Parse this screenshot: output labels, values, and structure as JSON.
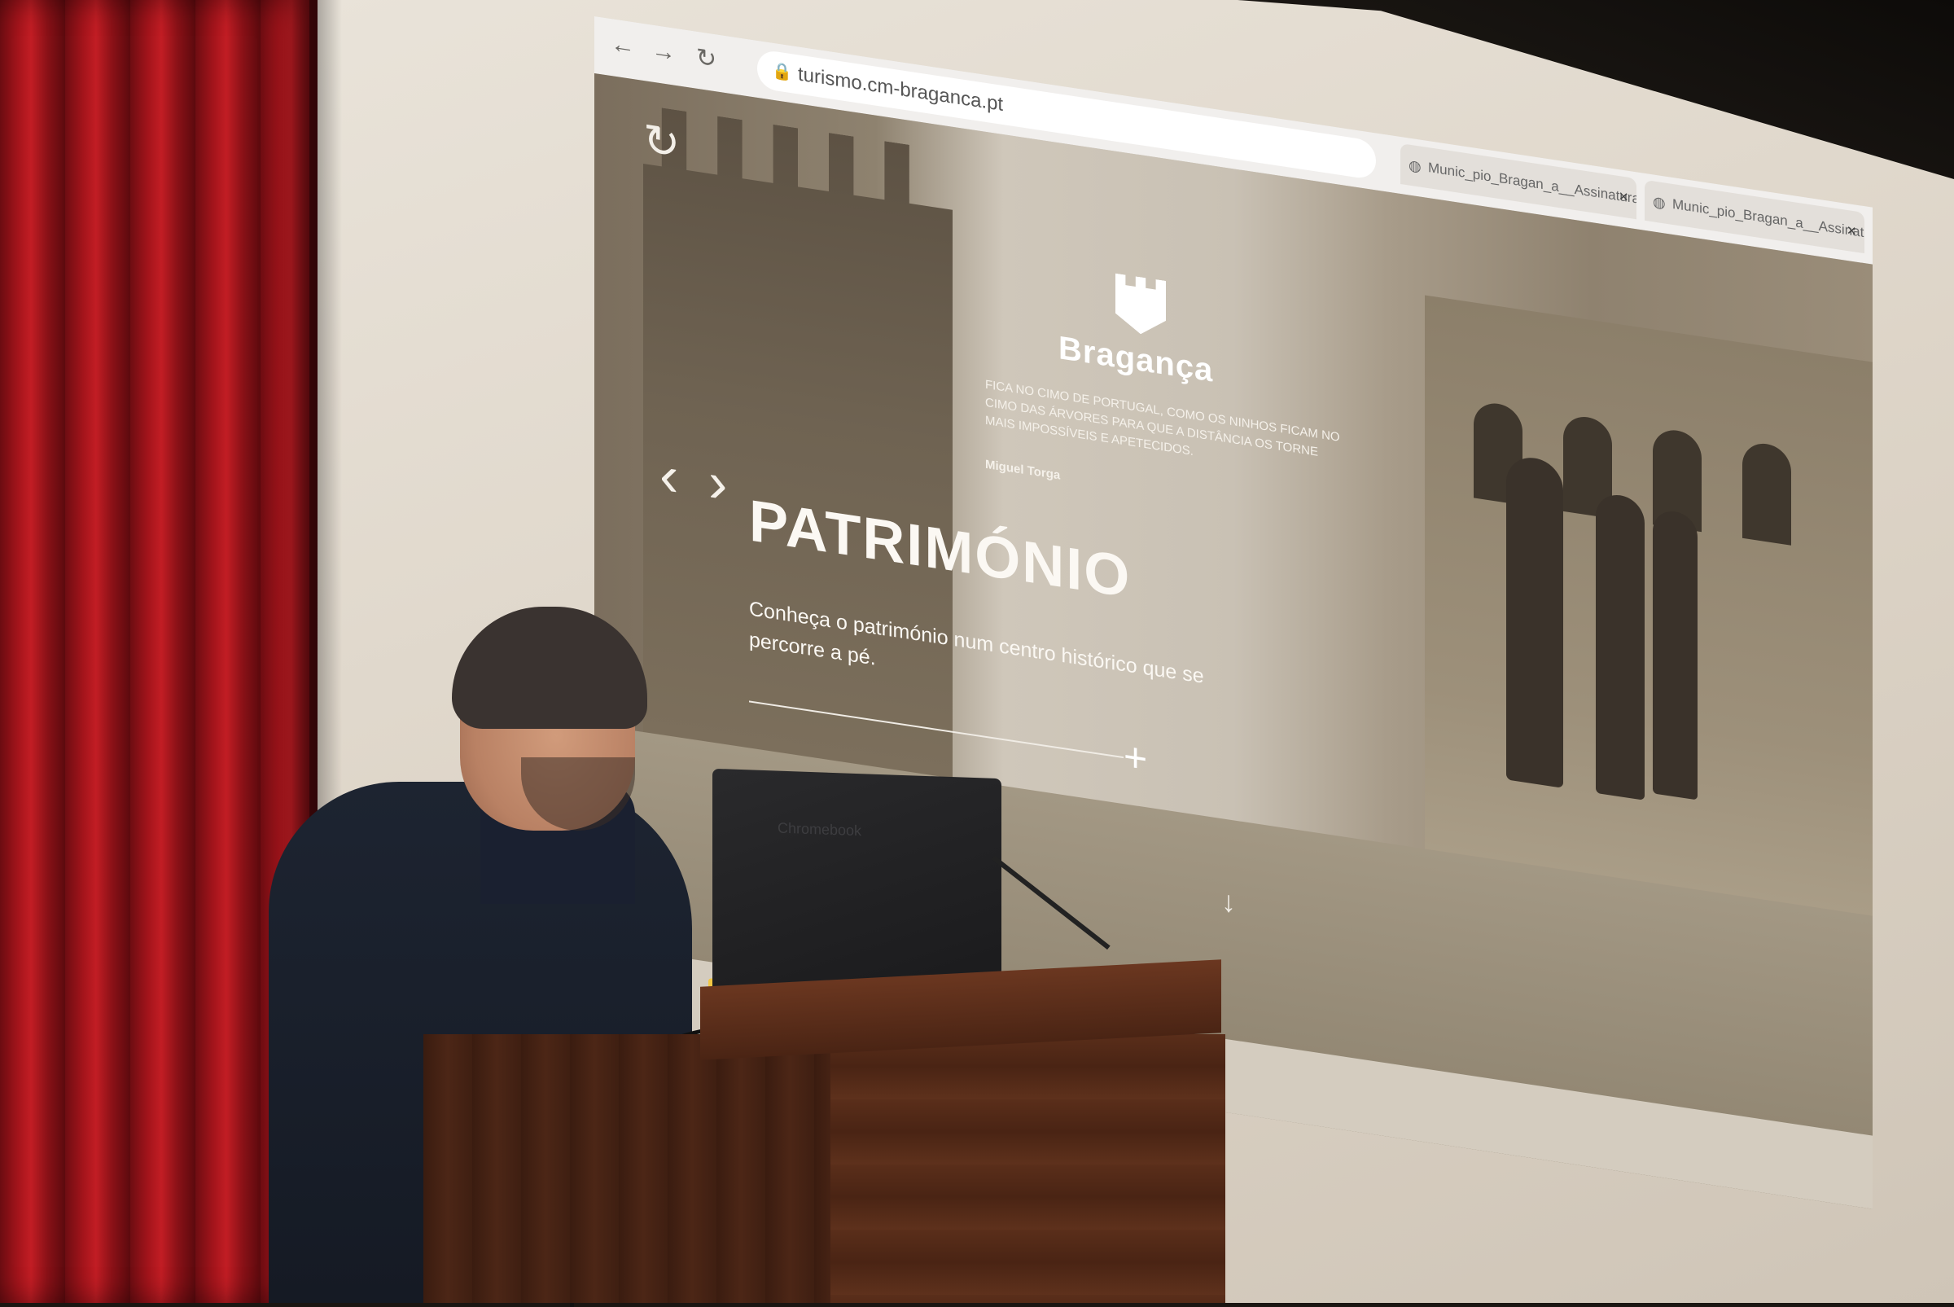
{
  "browser": {
    "url": "turismo.cm-braganca.pt",
    "tabs": [
      {
        "label": "Munic_pio_Bragan_a__Assinatura"
      },
      {
        "label": "Munic_pio_Bragan_a__Assinatura"
      }
    ],
    "top_tab_fragment": "Bragança"
  },
  "site": {
    "brand": "Bragança",
    "quote": "FICA NO CIMO DE PORTUGAL, COMO OS NINHOS FICAM NO CIMO DAS ÁRVORES PARA QUE A DISTÂNCIA OS TORNE MAIS IMPOSSÍVEIS E APETECIDOS.",
    "quote_author": "Miguel Torga",
    "heading": "PATRIMÓNIO",
    "subtext": "Conheça o património num centro histórico que se percorre a pé.",
    "icons": {
      "prev": "‹",
      "next": "›",
      "plus": "+",
      "down": "↓"
    }
  },
  "laptop": {
    "brand": "Chromebook"
  }
}
